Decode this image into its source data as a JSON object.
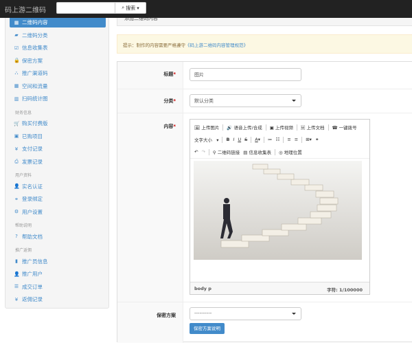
{
  "header": {
    "brand": "码上游二维码",
    "search_placeholder": "",
    "search_button": "搜索"
  },
  "breadcrumb": "添加二维码内容",
  "sidebar": {
    "items": [
      {
        "label": "二维码内容",
        "icon": "qrcode-icon",
        "glyph": "▦",
        "active": true
      },
      {
        "label": "二维码分类",
        "icon": "folder-open-icon",
        "glyph": "▰"
      },
      {
        "label": "信息收集表",
        "icon": "check-square-icon",
        "glyph": "☑"
      },
      {
        "label": "保密方案",
        "icon": "lock-icon",
        "glyph": "🔒"
      },
      {
        "label": "推广渠道码",
        "icon": "sitemap-icon",
        "glyph": "⛬"
      },
      {
        "label": "空间和流量",
        "icon": "th-large-icon",
        "glyph": "▦"
      },
      {
        "label": "扫码统计图",
        "icon": "bar-chart-icon",
        "glyph": "▥"
      }
    ],
    "sections": [
      {
        "title": "财务信息",
        "items": [
          {
            "label": "购买付费版",
            "icon": "cart-icon",
            "glyph": "🛒"
          },
          {
            "label": "已购项目",
            "icon": "calendar-check-icon",
            "glyph": "▣"
          },
          {
            "label": "支付记录",
            "icon": "yen-icon",
            "glyph": "¥"
          },
          {
            "label": "发票记录",
            "icon": "print-icon",
            "glyph": "⎙"
          }
        ]
      },
      {
        "title": "用户资料",
        "items": [
          {
            "label": "实名认证",
            "icon": "user-icon",
            "glyph": "👤"
          },
          {
            "label": "登录绑定",
            "icon": "link-icon",
            "glyph": "⚭"
          },
          {
            "label": "用户设置",
            "icon": "gear-icon",
            "glyph": "⚙"
          }
        ]
      },
      {
        "title": "帮助说明",
        "items": [
          {
            "label": "帮助文档",
            "icon": "question-circle-icon",
            "glyph": "?"
          }
        ]
      },
      {
        "title": "推广返佣",
        "items": [
          {
            "label": "推广员信息",
            "icon": "file-icon",
            "glyph": "▮"
          },
          {
            "label": "推广用户",
            "icon": "user-icon",
            "glyph": "👤"
          },
          {
            "label": "成交订单",
            "icon": "list-icon",
            "glyph": "☰"
          },
          {
            "label": "返佣记录",
            "icon": "yen-icon",
            "glyph": "¥"
          }
        ]
      }
    ]
  },
  "alert": {
    "prefix": "提示：制作的内容需要严格遵守",
    "link": "《码上游二维码内容管理规范》"
  },
  "form": {
    "title_label": "标题",
    "title_value": "图片",
    "category_label": "分类",
    "category_value": "默认分类",
    "content_label": "内容",
    "secret_label": "保密方案",
    "secret_value": "----------",
    "secret_button": "保密方案说明"
  },
  "editor": {
    "row1": [
      "上传图片",
      "语音上传/合成",
      "上传视频",
      "上传文档",
      "一键拨号"
    ],
    "font_size": "文字大小",
    "row3": [
      "二维码链接",
      "信息收集表",
      "地理位置"
    ],
    "path": "body  p",
    "count": "字符: 1/100000"
  },
  "colors": {
    "primary": "#428bca",
    "header": "#222222",
    "alert_bg": "#fcf8e3"
  }
}
